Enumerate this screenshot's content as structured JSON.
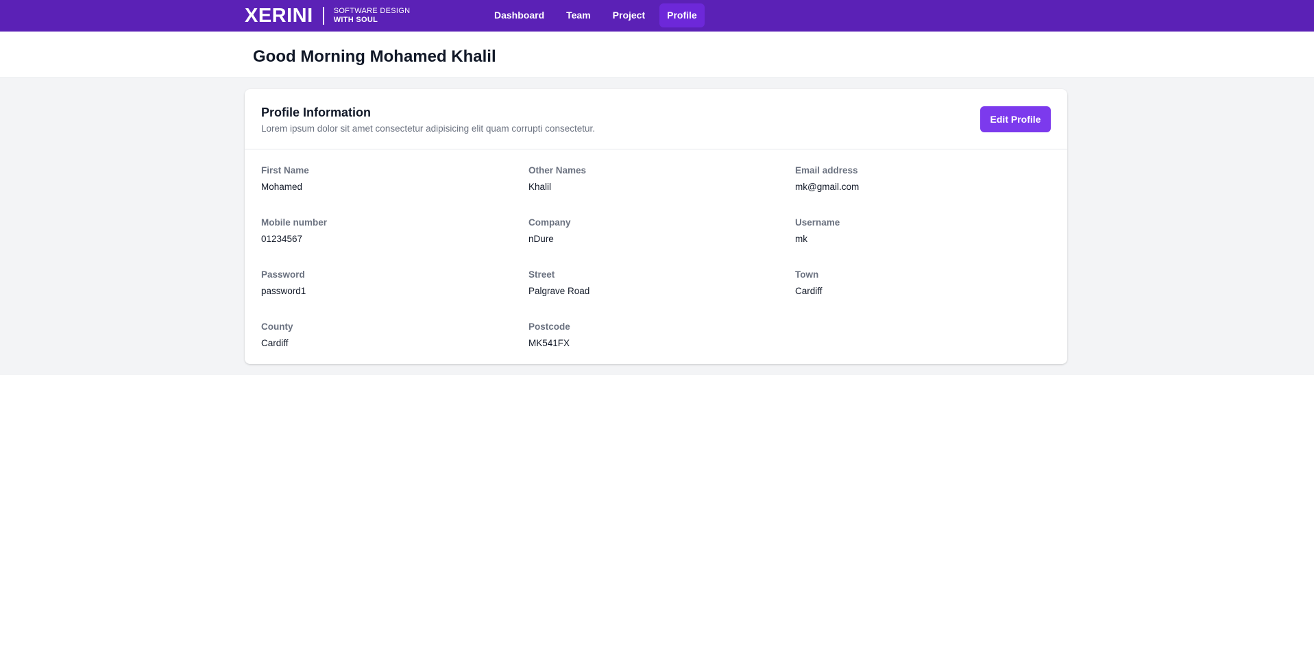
{
  "brand": {
    "logo": "XERINI",
    "tagline_line1": "SOFTWARE DESIGN",
    "tagline_line2": "WITH SOUL"
  },
  "nav": {
    "items": [
      {
        "label": "Dashboard"
      },
      {
        "label": "Team"
      },
      {
        "label": "Project"
      },
      {
        "label": "Profile",
        "active": true
      }
    ]
  },
  "header": {
    "greeting": "Good Morning Mohamed Khalil"
  },
  "profile": {
    "title": "Profile Information",
    "subtitle": "Lorem ipsum dolor sit amet consectetur adipisicing elit quam corrupti consectetur.",
    "edit_label": "Edit Profile",
    "fields": [
      {
        "label": "First Name",
        "value": "Mohamed"
      },
      {
        "label": "Other Names",
        "value": "Khalil"
      },
      {
        "label": "Email address",
        "value": "mk@gmail.com"
      },
      {
        "label": "Mobile number",
        "value": "01234567"
      },
      {
        "label": "Company",
        "value": "nDure"
      },
      {
        "label": "Username",
        "value": "mk"
      },
      {
        "label": "Password",
        "value": "password1"
      },
      {
        "label": "Street",
        "value": "Palgrave Road"
      },
      {
        "label": "Town",
        "value": "Cardiff"
      },
      {
        "label": "County",
        "value": "Cardiff"
      },
      {
        "label": "Postcode",
        "value": "MK541FX"
      }
    ]
  },
  "colors": {
    "topbar": "#5b21b6",
    "nav_active": "#6d28d9",
    "button": "#7c3aed",
    "page_bg": "#f3f4f6"
  }
}
